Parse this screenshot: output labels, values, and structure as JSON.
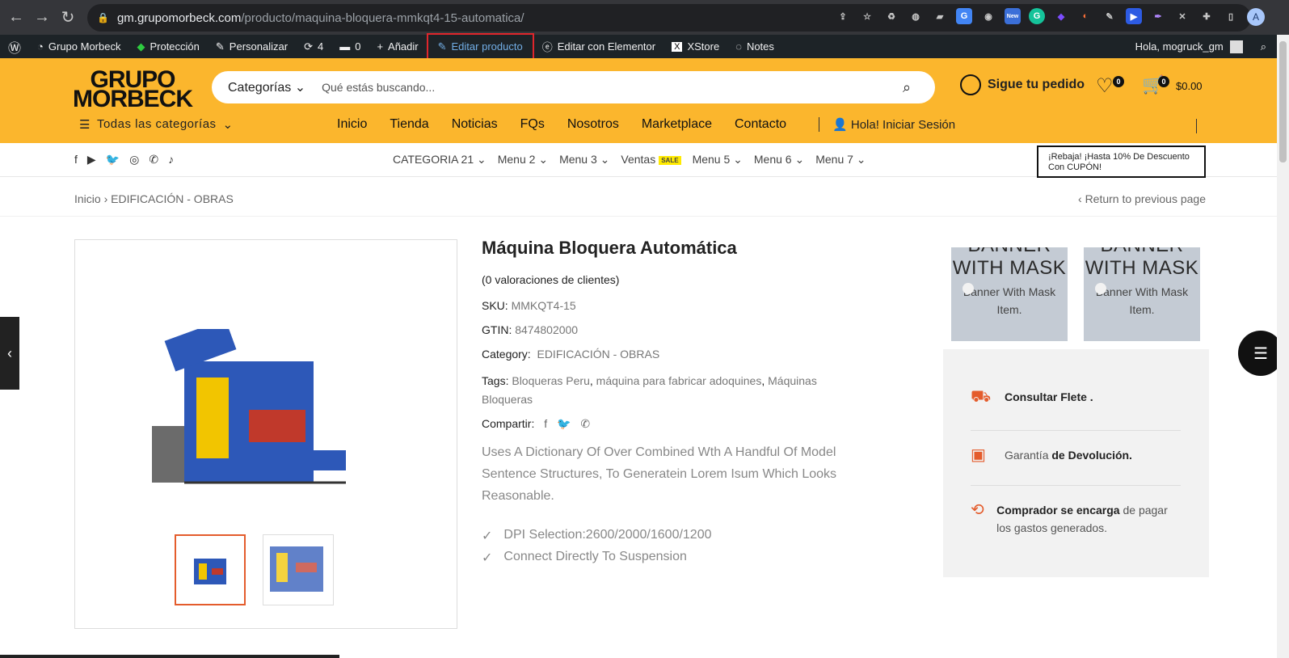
{
  "browser": {
    "url_host": "gm.grupomorbeck.com",
    "url_path": "/producto/maquina-bloquera-mmkqt4-15-automatica/",
    "profile_initial": "A",
    "ext_new_badge": "New"
  },
  "wpbar": {
    "site": "Grupo Morbeck",
    "protection": "Protección",
    "customize": "Personalizar",
    "updates": "4",
    "comments": "0",
    "add": "Añadir",
    "edit_product": "Editar producto",
    "elementor": "Editar con Elementor",
    "xstore": "XStore",
    "notes": "Notes",
    "greeting": "Hola, mogruck_gm"
  },
  "header": {
    "logo_line1": "GRUPO",
    "logo_line2": "MORBECK",
    "search_category": "Categorías",
    "search_placeholder": "Qué estás buscando...",
    "track_order": "Sigue tu pedido",
    "wishlist_count": "0",
    "cart_count": "0",
    "cart_total": "$0.00",
    "all_categories": "Todas las categorías",
    "nav": [
      "Inicio",
      "Tienda",
      "Noticias",
      "FQs",
      "Nosotros",
      "Marketplace",
      "Contacto"
    ],
    "login": "Hola! Iniciar Sesión"
  },
  "subnav": {
    "menus": [
      "CATEGORIA 21",
      "Menu 2",
      "Menu 3",
      "Ventas",
      "Menu 5",
      "Menu 6",
      "Menu 7"
    ],
    "sale_badge": "SALE",
    "promo": "¡Rebaja! ¡Hasta 10% De Descuento Con CUPÓN!"
  },
  "breadcrumb": {
    "home": "Inicio",
    "category": "EDIFICACIÓN - OBRAS",
    "back": "Return to previous page"
  },
  "product": {
    "title": "Máquina Bloquera Automática",
    "reviews": "(0 valoraciones de clientes)",
    "sku_label": "SKU:",
    "sku": "MMKQT4-15",
    "gtin_label": "GTIN:",
    "gtin": "8474802000",
    "category_label": "Category:",
    "category": "EDIFICACIÓN - OBRAS",
    "tags_label": "Tags:",
    "tag1": "Bloqueras Peru",
    "tag2": "máquina para fabricar adoquines",
    "tag3": "Máquinas Bloqueras",
    "share_label": "Compartir:",
    "description": "Uses A Dictionary Of Over Combined Wth A Handful Of Model Sentence Structures, To Generatein Lorem Isum Which Looks Reasonable.",
    "feature1": "DPI Selection:2600/2000/1600/1200",
    "feature2": "Connect Directly To Suspension"
  },
  "banners": [
    {
      "big": "BANNER WITH MASK",
      "small": "Banner With Mask Item."
    },
    {
      "big": "BANNER WITH MASK",
      "small": "Banner With Mask Item."
    }
  ],
  "info": {
    "row1_bold": "Consultar Flete .",
    "row2_text": "Garantía",
    "row2_bold": "de Devolución.",
    "row3_bold": "Comprador se encarga",
    "row3_text": "de pagar los gastos generados."
  },
  "colors": {
    "header_yellow": "#fbb62d",
    "accent_orange": "#e45c2c",
    "wp_admin_bar": "#1d2327"
  }
}
